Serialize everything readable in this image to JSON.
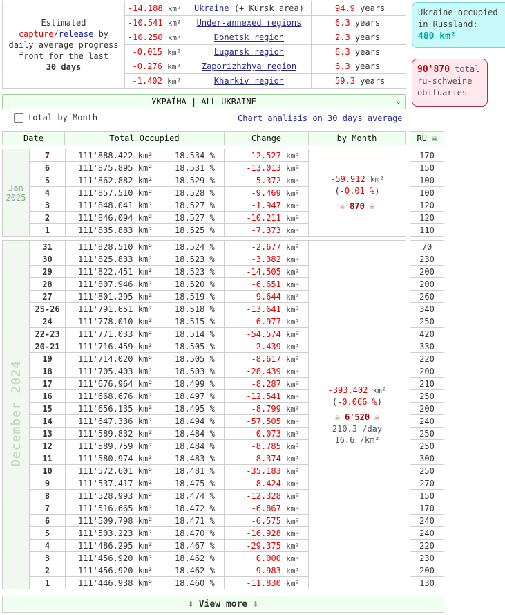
{
  "summary": {
    "description_pre": "Estimated",
    "description_capture": "capture",
    "description_sep": "/",
    "description_release": "release",
    "description_by": "by",
    "description_rest": "daily average progress front for the last",
    "description_days": "30 days",
    "unit": "km²",
    "years_label": "years",
    "rows": [
      {
        "area": "-14.188",
        "region": "Ukraine",
        "region_extra": " (+ Kursk area)",
        "years": "94.9"
      },
      {
        "area": "-10.541",
        "region": "Under-annexed regions",
        "region_extra": "",
        "years": "6.3"
      },
      {
        "area": "-10.250",
        "region": "Donetsk region",
        "region_extra": "",
        "years": "2.3"
      },
      {
        "area": "-0.015",
        "region": "Lugansk region",
        "region_extra": "",
        "years": "6.3"
      },
      {
        "area": "-0.276",
        "region": "Zaporizhzhya region",
        "region_extra": "",
        "years": "6.3"
      },
      {
        "area": "-1.402",
        "region": "Kharkiv region",
        "region_extra": "",
        "years": "59.3"
      }
    ]
  },
  "occupied_box": {
    "line1": "Ukraine occupied",
    "line2": "in Russland:",
    "value": "480 km²"
  },
  "obit_box": {
    "value": "90'870",
    "label1": "total",
    "line2": "ru-schweine",
    "line3": "obituaries"
  },
  "region_select": {
    "selected": "УКРАЇНА | ALL UKRAINE"
  },
  "by_month": {
    "label": "total by Month",
    "checked": false
  },
  "chart_link": "Chart analisis on 30 days average",
  "headers": {
    "date": "Date",
    "total": "Total Occupied",
    "change": "Change",
    "by_month": "by Month",
    "ru": "RU ☠"
  },
  "units": {
    "km": "km²",
    "pct": "%"
  },
  "jan": {
    "label_month": "Jan",
    "label_year": "2025",
    "summary": {
      "change": "-59.912",
      "pct": "-0.01",
      "skull": "☠",
      "obits": "870"
    },
    "rows": [
      {
        "day": "7",
        "total": "111'888.422",
        "pct": "18.534",
        "change": "-12.527",
        "ru": "170"
      },
      {
        "day": "6",
        "total": "111'875.895",
        "pct": "18.531",
        "change": "-13.013",
        "ru": "150"
      },
      {
        "day": "5",
        "total": "111'862.882",
        "pct": "18.529",
        "change": "-5.372",
        "ru": "100"
      },
      {
        "day": "4",
        "total": "111'857.510",
        "pct": "18.528",
        "change": "-9.469",
        "ru": "100"
      },
      {
        "day": "3",
        "total": "111'848.041",
        "pct": "18.527",
        "change": "-1.947",
        "ru": "120"
      },
      {
        "day": "2",
        "total": "111'846.094",
        "pct": "18.527",
        "change": "-10.211",
        "ru": "120"
      },
      {
        "day": "1",
        "total": "111'835.883",
        "pct": "18.525",
        "change": "-7.373",
        "ru": "110"
      }
    ]
  },
  "dec": {
    "label": "December 2024",
    "summary": {
      "change": "-393.402",
      "pct": "-0.066",
      "skull": "☠",
      "obits": "6'520",
      "per_day": "210.3 /day",
      "per_km": "16.6 /km²"
    },
    "rows": [
      {
        "day": "31",
        "total": "111'828.510",
        "pct": "18.524",
        "change": "-2.677",
        "ru": "70"
      },
      {
        "day": "30",
        "total": "111'825.833",
        "pct": "18.523",
        "change": "-3.382",
        "ru": "230"
      },
      {
        "day": "29",
        "total": "111'822.451",
        "pct": "18.523",
        "change": "-14.505",
        "ru": "200"
      },
      {
        "day": "28",
        "total": "111'807.946",
        "pct": "18.520",
        "change": "-6.651",
        "ru": "200"
      },
      {
        "day": "27",
        "total": "111'801.295",
        "pct": "18.519",
        "change": "-9.644",
        "ru": "260"
      },
      {
        "day": "25-26",
        "total": "111'791.651",
        "pct": "18.518",
        "change": "-13.641",
        "ru": "340"
      },
      {
        "day": "24",
        "total": "111'778.010",
        "pct": "18.515",
        "change": "-6.977",
        "ru": "250"
      },
      {
        "day": "22-23",
        "total": "111'771.033",
        "pct": "18.514",
        "change": "-54.574",
        "ru": "420"
      },
      {
        "day": "20-21",
        "total": "111'716.459",
        "pct": "18.505",
        "change": "-2.439",
        "ru": "330"
      },
      {
        "day": "19",
        "total": "111'714.020",
        "pct": "18.505",
        "change": "-8.617",
        "ru": "220"
      },
      {
        "day": "18",
        "total": "111'705.403",
        "pct": "18.503",
        "change": "-28.439",
        "ru": "200"
      },
      {
        "day": "17",
        "total": "111'676.964",
        "pct": "18.499",
        "change": "-8.287",
        "ru": "210"
      },
      {
        "day": "16",
        "total": "111'668.676",
        "pct": "18.497",
        "change": "-12.541",
        "ru": "250"
      },
      {
        "day": "15",
        "total": "111'656.135",
        "pct": "18.495",
        "change": "-8.799",
        "ru": "200"
      },
      {
        "day": "14",
        "total": "111'647.336",
        "pct": "18.494",
        "change": "-57.505",
        "ru": "240"
      },
      {
        "day": "13",
        "total": "111'589.832",
        "pct": "18.484",
        "change": "-0.073",
        "ru": "250"
      },
      {
        "day": "12",
        "total": "111'589.759",
        "pct": "18.484",
        "change": "-8.785",
        "ru": "250"
      },
      {
        "day": "11",
        "total": "111'580.974",
        "pct": "18.483",
        "change": "-8.374",
        "ru": "300"
      },
      {
        "day": "10",
        "total": "111'572.601",
        "pct": "18.481",
        "change": "-35.183",
        "ru": "250"
      },
      {
        "day": "9",
        "total": "111'537.417",
        "pct": "18.475",
        "change": "-8.424",
        "ru": "270"
      },
      {
        "day": "8",
        "total": "111'528.993",
        "pct": "18.474",
        "change": "-12.328",
        "ru": "150"
      },
      {
        "day": "7",
        "total": "111'516.665",
        "pct": "18.472",
        "change": "-6.867",
        "ru": "170"
      },
      {
        "day": "6",
        "total": "111'509.798",
        "pct": "18.471",
        "change": "-6.575",
        "ru": "240"
      },
      {
        "day": "5",
        "total": "111'503.223",
        "pct": "18.470",
        "change": "-16.928",
        "ru": "240"
      },
      {
        "day": "4",
        "total": "111'486.295",
        "pct": "18.467",
        "change": "-29.375",
        "ru": "220"
      },
      {
        "day": "3",
        "total": "111'456.920",
        "pct": "18.462",
        "change": "0.000",
        "ru": "230"
      },
      {
        "day": "2",
        "total": "111'456.920",
        "pct": "18.462",
        "change": "-9.983",
        "ru": "200"
      },
      {
        "day": "1",
        "total": "111'446.938",
        "pct": "18.460",
        "change": "-11.830",
        "ru": "130"
      }
    ]
  },
  "view_more": "⇩ View more ⇩"
}
